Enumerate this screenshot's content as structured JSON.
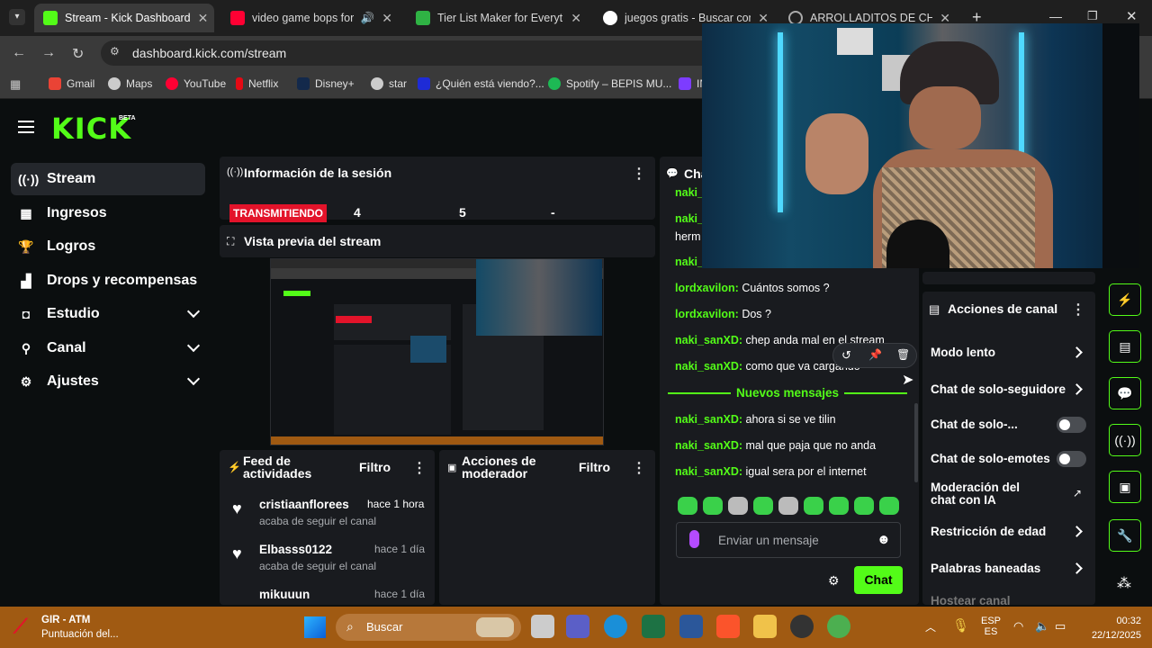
{
  "browser": {
    "tabs": [
      {
        "title": "Stream - Kick Dashboard",
        "color": "#53fc18"
      },
      {
        "title": "video game bops for gri",
        "color": "#ff0033"
      },
      {
        "title": "Tier List Maker for Everythin",
        "color": "#2fb344"
      },
      {
        "title": "juegos gratis - Buscar con G",
        "color": "#4285f4"
      },
      {
        "title": "ARROLLADITOS DE CHOCO",
        "color": "#aaaaaa"
      }
    ],
    "url": "dashboard.kick.com/stream",
    "bookmarks": [
      "Gmail",
      "Maps",
      "YouTube",
      "Netflix",
      "Disney+",
      "star",
      "¿Quién está viendo?...",
      "Spotify – BEPIS MU...",
      "IN"
    ]
  },
  "kick": {
    "logo": "KICK",
    "logo_badge": "BETA",
    "sidebar": [
      {
        "label": "Stream",
        "icon": "broadcast-icon"
      },
      {
        "label": "Ingresos",
        "icon": "money-icon"
      },
      {
        "label": "Logros",
        "icon": "trophy-icon"
      },
      {
        "label": "Drops y recompensas",
        "icon": "gift-icon"
      },
      {
        "label": "Estudio",
        "icon": "studio-icon"
      },
      {
        "label": "Canal",
        "icon": "channel-icon"
      },
      {
        "label": "Ajustes",
        "icon": "gear-icon"
      }
    ],
    "session": {
      "title": "Información de la sesión",
      "status": "TRANSMITIENDO",
      "stat1": "4",
      "stat2": "5",
      "stat3": "-"
    },
    "preview": {
      "title": "Vista previa del stream"
    },
    "feed": {
      "title": "Feed de actividades",
      "filter": "Filtro",
      "items": [
        {
          "user": "cristiaanflorees",
          "time": "hace 1 hora",
          "action": "acaba de seguir el canal"
        },
        {
          "user": "Elbasss0122",
          "time": "hace 1 día",
          "action": "acaba de seguir el canal"
        },
        {
          "user": "mikuuun",
          "time": "hace 1 día",
          "action": ""
        }
      ]
    },
    "mod_actions": {
      "title": "Acciones de moderador",
      "filter": "Filtro"
    },
    "chat": {
      "title": "Cha",
      "messages": [
        {
          "user": "naki_",
          "text": ""
        },
        {
          "user": "naki_",
          "text": ""
        },
        {
          "user": "",
          "text": "herm"
        },
        {
          "user": "naki_",
          "text": ""
        },
        {
          "user": "lordxavilon:",
          "text": " Cuántos somos ?"
        },
        {
          "user": "lordxavilon:",
          "text": " Dos ?"
        },
        {
          "user": "naki_sanXD:",
          "text": " chep anda mal en el stream"
        },
        {
          "user": "naki_sanXD:",
          "text": " como que va cargando"
        }
      ],
      "new_messages": "Nuevos mensajes",
      "new": [
        {
          "user": "naki_sanXD:",
          "text": " ahora si se ve tilin"
        },
        {
          "user": "naki_sanXD:",
          "text": " mal que paja que no anda"
        },
        {
          "user": "naki_sanXD:",
          "text": " igual sera por el internet"
        }
      ],
      "placeholder": "Enviar un mensaje",
      "send": "Chat"
    },
    "channel_actions": {
      "title": "Acciones de canal",
      "items": [
        {
          "label": "Modo lento",
          "control": "arrow"
        },
        {
          "label": "Chat de solo-seguidore",
          "control": "arrow"
        },
        {
          "label": "Chat de solo-...",
          "control": "toggle",
          "on": false
        },
        {
          "label": "Chat de solo-emotes",
          "control": "toggle",
          "on": false
        },
        {
          "label": "Moderación del chat con IA",
          "control": "external"
        },
        {
          "label": "Restricción de edad",
          "control": "arrow"
        },
        {
          "label": "Palabras baneadas",
          "control": "arrow"
        },
        {
          "label": "Hostear canal",
          "control": "none"
        }
      ]
    },
    "accent": "#53fc18",
    "live_red": "#e3132a"
  },
  "taskbar": {
    "widget_title": "GIR - ATM",
    "widget_sub": "Puntuación del...",
    "search": "Buscar",
    "lang1": "ESP",
    "lang2": "ES",
    "time": "00:32",
    "date": "22/12/2025"
  }
}
